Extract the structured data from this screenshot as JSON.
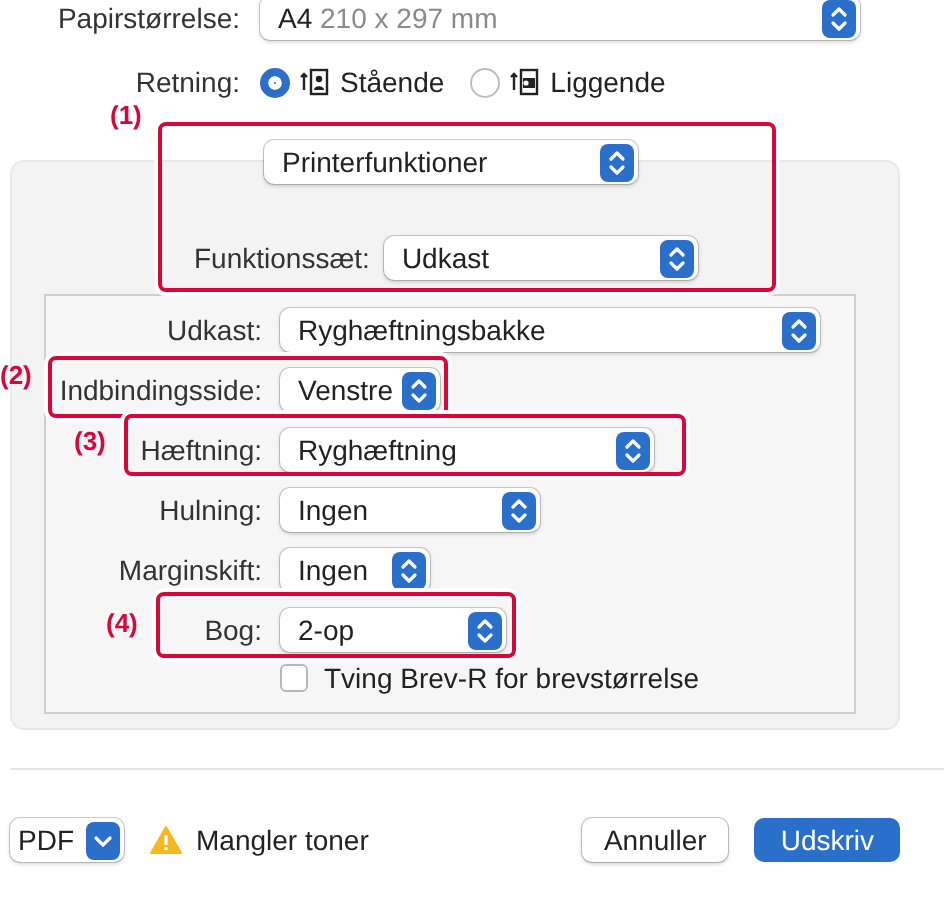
{
  "paper_size": {
    "label": "Papirstørrelse:",
    "value": "A4",
    "detail": "210 x 297 mm"
  },
  "orientation": {
    "label": "Retning:",
    "options": [
      {
        "label": "Stående",
        "kind": "portrait",
        "selected": true
      },
      {
        "label": "Liggende",
        "kind": "landscape",
        "selected": false
      }
    ]
  },
  "panel_menu": {
    "value": "Printerfunktioner"
  },
  "feature_set": {
    "label": "Funktionssæt:",
    "value": "Udkast"
  },
  "settings": [
    {
      "label": "Udkast:",
      "value": "Ryghæftningsbakke"
    },
    {
      "label": "Indbindingsside:",
      "value": "Venstre"
    },
    {
      "label": "Hæftning:",
      "value": "Ryghæftning"
    },
    {
      "label": "Hulning:",
      "value": "Ingen"
    },
    {
      "label": "Marginskift:",
      "value": "Ingen"
    },
    {
      "label": "Bog:",
      "value": "2-op"
    }
  ],
  "checkbox": {
    "label": "Tving Brev-R for brevstørrelse",
    "checked": false
  },
  "callouts": [
    {
      "label": "(1)"
    },
    {
      "label": "(2)"
    },
    {
      "label": "(3)"
    },
    {
      "label": "(4)"
    }
  ],
  "footer": {
    "pdf": "PDF",
    "warning": "Mangler toner",
    "buttons": [
      {
        "label": "Annuller",
        "kind": "secondary"
      },
      {
        "label": "Udskriv",
        "kind": "primary"
      }
    ]
  }
}
